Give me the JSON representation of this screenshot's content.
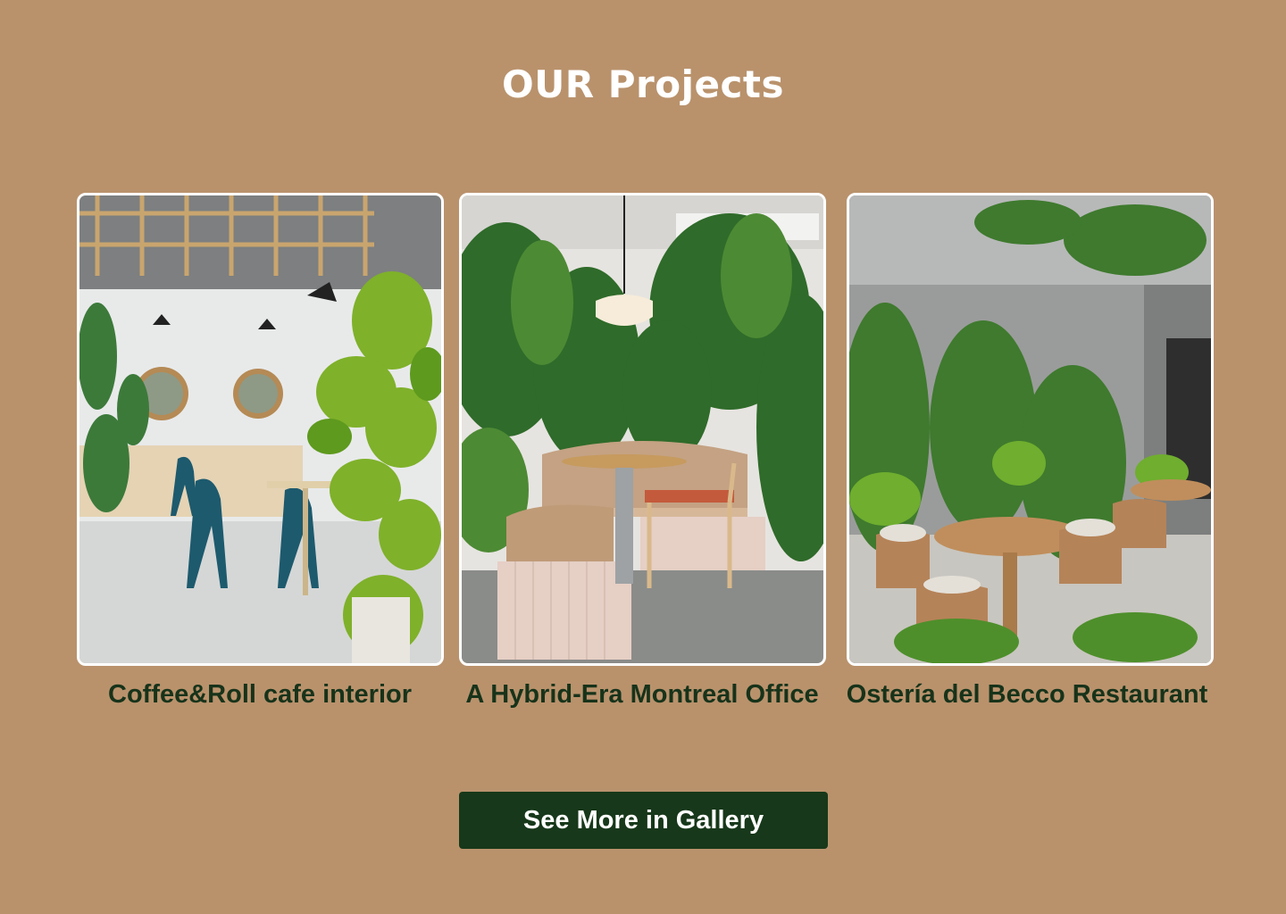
{
  "header": {
    "title": "OUR Projects"
  },
  "projects": [
    {
      "caption": "Coffee&Roll cafe interior",
      "image_subject": "cafe-interior-photo"
    },
    {
      "caption": "A Hybrid-Era Montreal Office",
      "image_subject": "office-lounge-photo"
    },
    {
      "caption": "Ostería del Becco Restaurant",
      "image_subject": "restaurant-courtyard-photo"
    }
  ],
  "cta": {
    "label": "See More in Gallery"
  },
  "colors": {
    "background": "#b9926c",
    "title": "#ffffff",
    "caption": "#17331a",
    "button_bg": "#17381a",
    "button_text": "#ffffff"
  }
}
